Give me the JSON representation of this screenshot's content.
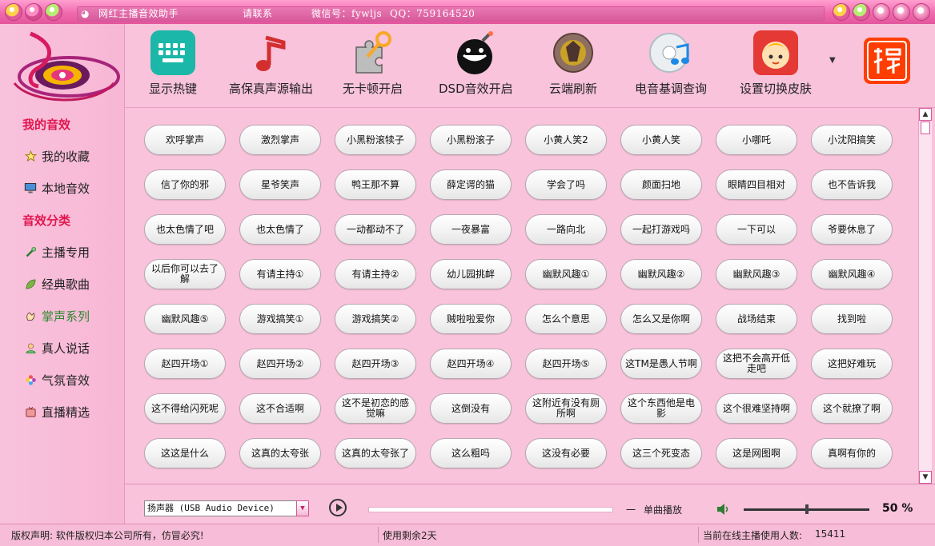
{
  "window": {
    "title_app": "网红主播音效助手",
    "title_contact": "请联系",
    "title_wechat": "微信号：fywljs",
    "title_qq": "QQ：759164520"
  },
  "toolbar": {
    "tools": [
      {
        "label": "显示热键",
        "icon": "keyboard-icon"
      },
      {
        "label": "高保真声源输出",
        "icon": "music-note-icon"
      },
      {
        "label": "无卡顿开启",
        "icon": "puzzle-key-icon"
      },
      {
        "label": "DSD音效开启",
        "icon": "bomb-icon"
      },
      {
        "label": "云端刷新",
        "icon": "game-emblem-icon"
      },
      {
        "label": "电音基调查询",
        "icon": "music-disc-icon"
      },
      {
        "label": "设置切换皮肤",
        "icon": "anime-avatar-icon"
      }
    ],
    "taobao_icon": "taobao-icon"
  },
  "sidebar": {
    "section_my": "我的音效",
    "my_items": [
      {
        "label": "我的收藏",
        "icon": "star-icon"
      },
      {
        "label": "本地音效",
        "icon": "monitor-icon"
      }
    ],
    "section_category": "音效分类",
    "category_items": [
      {
        "label": "主播专用",
        "icon": "microphone-icon"
      },
      {
        "label": "经典歌曲",
        "icon": "leaf-icon"
      },
      {
        "label": "掌声系列",
        "icon": "clap-icon"
      },
      {
        "label": "真人说话",
        "icon": "person-icon"
      },
      {
        "label": "气氛音效",
        "icon": "flower-icon"
      },
      {
        "label": "直播精选",
        "icon": "tv-icon"
      }
    ]
  },
  "sounds": [
    [
      "欢呼掌声",
      "激烈掌声",
      "小黑粉滚犊子",
      "小黑粉滚子",
      "小黄人笑2",
      "小黄人笑",
      "小哪吒",
      "小沈阳搞笑"
    ],
    [
      "信了你的邪",
      "星爷笑声",
      "鸭王那不算",
      "薛定谔的猫",
      "学会了吗",
      "颜面扫地",
      "眼睛四目相对",
      "也不告诉我"
    ],
    [
      "也太色情了吧",
      "也太色情了",
      "一动都动不了",
      "一夜暴富",
      "一路向北",
      "一起打游戏吗",
      "一下可以",
      "爷要休息了"
    ],
    [
      "以后你可以去了解",
      "有请主持①",
      "有请主持②",
      "幼儿园挑衅",
      "幽默风趣①",
      "幽默风趣②",
      "幽默风趣③",
      "幽默风趣④"
    ],
    [
      "幽默风趣⑤",
      "游戏搞笑①",
      "游戏搞笑②",
      "贼啦啦爱你",
      "怎么个意思",
      "怎么又是你啊",
      "战场结束",
      "找到啦"
    ],
    [
      "赵四开场①",
      "赵四开场②",
      "赵四开场③",
      "赵四开场④",
      "赵四开场⑤",
      "这TM是愚人节啊",
      "这把不会高开低走吧",
      "这把好难玩"
    ],
    [
      "这不得给闪死呢",
      "这不合适啊",
      "这不是初恋的感觉嘛",
      "这倒没有",
      "这附近有没有厕所啊",
      "这个东西他是电影",
      "这个很难坚持啊",
      "这个就撩了啊"
    ],
    [
      "这这是什么",
      "这真的太夸张",
      "这真的太夸张了",
      "这么粗吗",
      "这没有必要",
      "这三个死变态",
      "这是网图啊",
      "真啊有你的"
    ]
  ],
  "player": {
    "device": "扬声器 (USB Audio Device)",
    "mode_dash": "一",
    "mode": "单曲播放",
    "volume_pct": "50 %",
    "volume": 0.5,
    "progress": 0
  },
  "status": {
    "copyright": "版权声明:  软件版权归本公司所有，仿冒必究!",
    "remaining": "使用剩余2天",
    "online_label": "当前在线主播使用人数:",
    "online_count": "15411"
  },
  "colors": {
    "background": "#f8c3db",
    "accent": "#e0174f",
    "titlebar": "#e978b2",
    "active_item": "#2d8a2d"
  }
}
